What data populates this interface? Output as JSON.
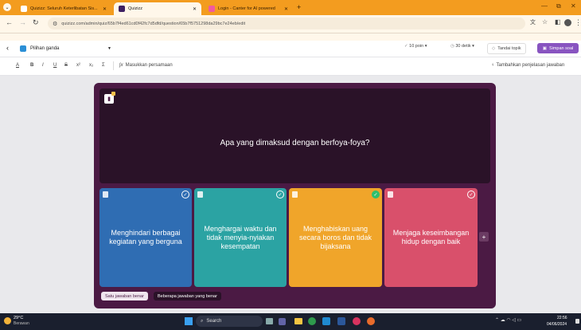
{
  "browser": {
    "tabs": [
      {
        "title": "Quizizz: Seluruh Keterlibatan Sis...",
        "active": false,
        "color": "#ffffff"
      },
      {
        "title": "Quizizz",
        "active": true,
        "color": "#3d2063"
      },
      {
        "title": "Login - Canter for AI powered",
        "active": false,
        "color": "#f05aa0"
      }
    ],
    "new_tab_symbol": "+",
    "url": "quizizz.com/admin/quiz/65b7f4ed61cd0f42fc7d5dfd/question/65b7f5751298da29bc7e24eb/edit"
  },
  "toolbar": {
    "question_type": "Pilihan ganda",
    "points": "10 poin",
    "time": "30 detik",
    "topic": "Tandai topik",
    "save": "Simpan soal"
  },
  "format_bar": {
    "buttons": [
      "A",
      "B",
      "I",
      "U",
      "S",
      "x²",
      "x₂",
      "Σ"
    ],
    "equation": "Masukkan persamaan",
    "explanation": "Tambahkan penjelasan jawaban"
  },
  "question": {
    "text": "Apa yang dimaksud dengan berfoya-foya?"
  },
  "answers": [
    {
      "text": "Menghindari berbagai kegiatan yang berguna",
      "color": "#2f6db3",
      "correct": false
    },
    {
      "text": "Menghargai waktu dan tidak menyia-nyiakan kesempatan",
      "color": "#2ba3a3",
      "correct": false
    },
    {
      "text": "Menghabiskan uang secara boros dan tidak bijaksana",
      "color": "#f0a52a",
      "correct": true
    },
    {
      "text": "Menjaga keseimbangan hidup dengan baik",
      "color": "#d9506b",
      "correct": false
    }
  ],
  "answer_modes": {
    "single": "Satu jawaban benar",
    "multiple": "Beberapa jawaban yang benar"
  },
  "taskbar": {
    "weather_temp": "29°C",
    "weather_desc": "Berawan",
    "search": "Search",
    "time": "22:56",
    "date": "04/06/2024"
  },
  "colors": {
    "tab_strip": "#f39c1f",
    "panel": "#4b1a44",
    "question_bg": "#2a1228",
    "save_button": "#8854c0"
  }
}
